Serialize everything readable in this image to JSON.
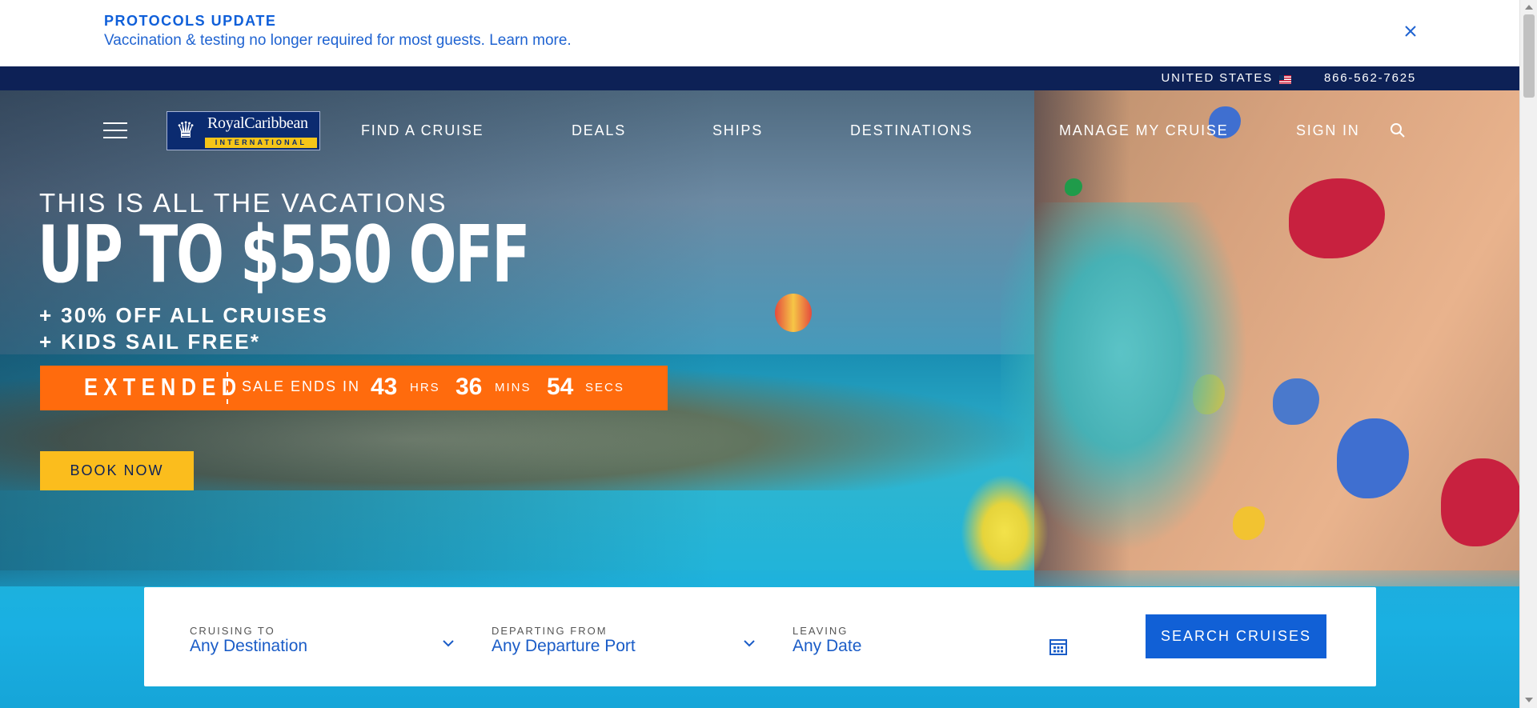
{
  "alert": {
    "title": "PROTOCOLS UPDATE",
    "text": "Vaccination & testing no longer required for most guests. Learn more."
  },
  "utility": {
    "country": "UNITED STATES",
    "phone": "866-562-7625"
  },
  "logo": {
    "name": "RoyalCaribbean",
    "sub": "INTERNATIONAL"
  },
  "nav": {
    "items": [
      "FIND A CRUISE",
      "DEALS",
      "SHIPS",
      "DESTINATIONS",
      "MANAGE MY CRUISE",
      "SIGN IN"
    ]
  },
  "promo": {
    "eyebrow": "THIS IS ALL THE VACATIONS",
    "headline": "UP TO $550 OFF",
    "line1": "+ 30% OFF ALL CRUISES",
    "line2": "+ KIDS SAIL FREE*",
    "banner": {
      "extended": "EXTENDED",
      "ends": "SALE ENDS IN",
      "hrs": "43",
      "hrs_unit": "HRS",
      "mins": "36",
      "mins_unit": "MINS",
      "secs": "54",
      "secs_unit": "SECS"
    },
    "cta": "BOOK NOW"
  },
  "search": {
    "cruising_label": "CRUISING TO",
    "cruising_value": "Any Destination",
    "departing_label": "DEPARTING FROM",
    "departing_value": "Any Departure Port",
    "leaving_label": "LEAVING",
    "leaving_value": "Any Date",
    "button": "SEARCH CRUISES"
  },
  "colors": {
    "brand_navy": "#0d2156",
    "link_blue": "#1160d6",
    "promo_orange": "#ff6b0d",
    "cta_yellow": "#fbbd1d"
  },
  "icons": [
    "close-icon",
    "flag-us-icon",
    "hamburger-icon",
    "search-icon",
    "chevron-down-icon",
    "calendar-icon",
    "crown-logo-icon"
  ]
}
